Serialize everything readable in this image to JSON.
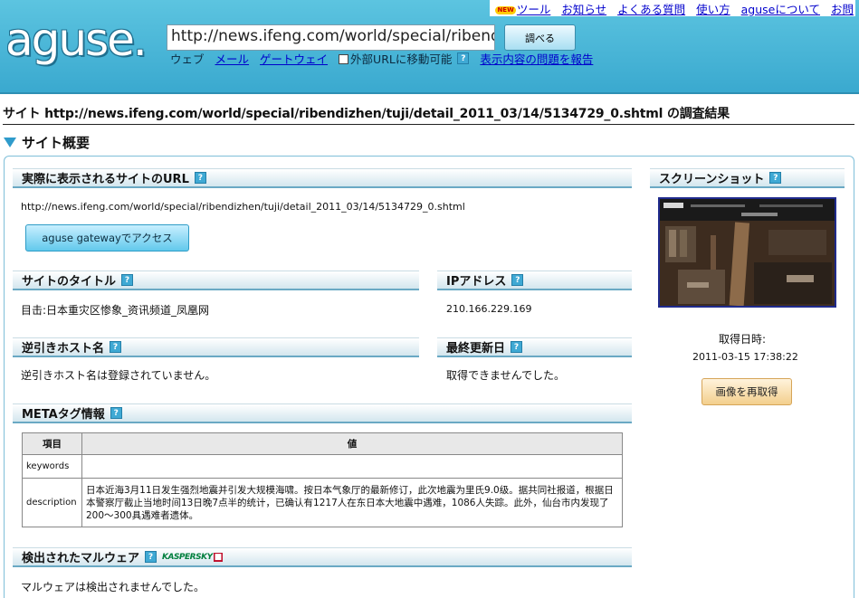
{
  "header": {
    "logo": "aguse.",
    "top_links": [
      "ツール",
      "お知らせ",
      "よくある質問",
      "使い方",
      "aguseについて",
      "お問"
    ],
    "new_badge": "NEW",
    "url_value": "http://news.ifeng.com/world/special/ribendizhen/tuji/detail_2011_03/14/5134729_0.shtml",
    "search_button": "調べる",
    "sub_web": "ウェブ",
    "sub_mail": "メール",
    "sub_gateway": "ゲートウェイ",
    "sub_checkbox": "外部URLに移動可能",
    "sub_report": "表示内容の問題を報告"
  },
  "page": {
    "title_prefix": "サイト",
    "title_url": "http://news.ifeng.com/world/special/ribendizhen/tuji/detail_2011_03/14/5134729_0.shtml",
    "title_suffix": "の調査結果",
    "section": "サイト概要"
  },
  "panels": {
    "actual_url_label": "実際に表示されるサイトのURL",
    "actual_url_value": "http://news.ifeng.com/world/special/ribendizhen/tuji/detail_2011_03/14/5134729_0.shtml",
    "gateway_button": "aguse gatewayでアクセス",
    "site_title_label": "サイトのタイトル",
    "site_title_value": "目击:日本重灾区惨象_资讯频道_凤凰网",
    "ip_label": "IPアドレス",
    "ip_value": "210.166.229.169",
    "rdns_label": "逆引きホスト名",
    "rdns_value": "逆引きホスト名は登録されていません。",
    "lastmod_label": "最終更新日",
    "lastmod_value": "取得できませんでした。",
    "meta_label": "METAタグ情報",
    "meta_col_item": "項目",
    "meta_col_value": "値",
    "meta_rows": [
      {
        "key": "keywords",
        "value": ""
      },
      {
        "key": "description",
        "value": "日本近海3月11日发生强烈地震并引发大规模海啸。按日本气象厅的最新修订，此次地震为里氏9.0级。据共同社报道，根据日本警察厅截止当地时间13日晚7点半的统计，已确认有1217人在东日本大地震中遇难，1086人失踪。此外，仙台市内发现了200～300具遇难者遗体。"
      }
    ],
    "malware_label": "検出されたマルウェア",
    "malware_vendor": "KASPERSKY",
    "malware_value": "マルウェアは検出されませんでした。",
    "screenshot_label": "スクリーンショット",
    "fetched_label": "取得日時:",
    "fetched_value": "2011-03-15 17:38:22",
    "reget_button": "画像を再取得",
    "help": "?"
  }
}
